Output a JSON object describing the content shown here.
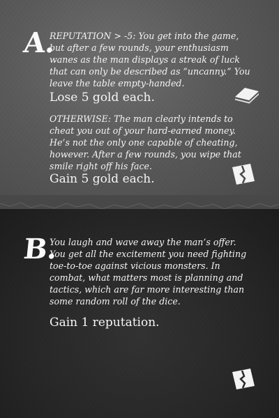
{
  "option_a": {
    "letter": "A.",
    "condition_text": "REPUTATION > -5: You get into the game, but after a few rounds, your enthusiasm wanes as the man displays a streak of luck that can only be described as “uncanny.” You leave the table empty-handed.",
    "condition_effect": "Lose 5 gold each.",
    "otherwise_text": "OTHERWISE: The man clearly intends to cheat you out of your hard-earned money. He’s not the only one capable of cheating, however. After a few rounds, you wipe that smile right off his face.",
    "otherwise_effect": "Gain 5 gold each.",
    "icons": [
      "card-stack-icon",
      "torn-card-icon"
    ]
  },
  "option_b": {
    "letter": "B.",
    "text": "You laugh and wave away the man’s offer. You get all the excitement you need fighting toe-to-toe against vicious monsters. In combat, what matters most is planning and tactics, which are far more interesting than some random roll of the dice.",
    "effect": "Gain 1 reputation.",
    "icons": [
      "torn-card-icon"
    ]
  },
  "colors": {
    "top_background": "#5a5a5a",
    "bottom_background": "#262626",
    "text": "#f4f4f4"
  }
}
